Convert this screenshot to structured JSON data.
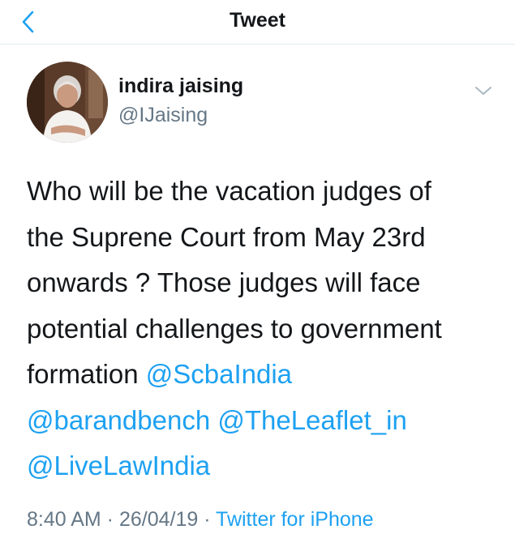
{
  "nav": {
    "title": "Tweet",
    "back_icon": "chevron-left-icon"
  },
  "author": {
    "display_name": "indira jaising",
    "handle": "@IJaising",
    "avatar_icon": "profile-photo"
  },
  "tweet": {
    "line1": "Who will be the vacation judges of",
    "line2": "the Suprene Court from May 23rd",
    "line3": "onwards ? Those judges will face",
    "line4": "potential challenges to government",
    "line5_text": "formation ",
    "mentions": [
      "@ScbaIndia",
      "@barandbench",
      "@TheLeaflet_in",
      "@LiveLawIndia"
    ]
  },
  "meta": {
    "time": "8:40 AM",
    "date": "26/04/19",
    "separator": " · ",
    "source": "Twitter for iPhone"
  },
  "colors": {
    "link": "#1da1f2",
    "secondary_text": "#657786",
    "primary_text": "#14171a",
    "divider": "#e1e8ed"
  },
  "icons": {
    "caret": "chevron-down-icon"
  }
}
